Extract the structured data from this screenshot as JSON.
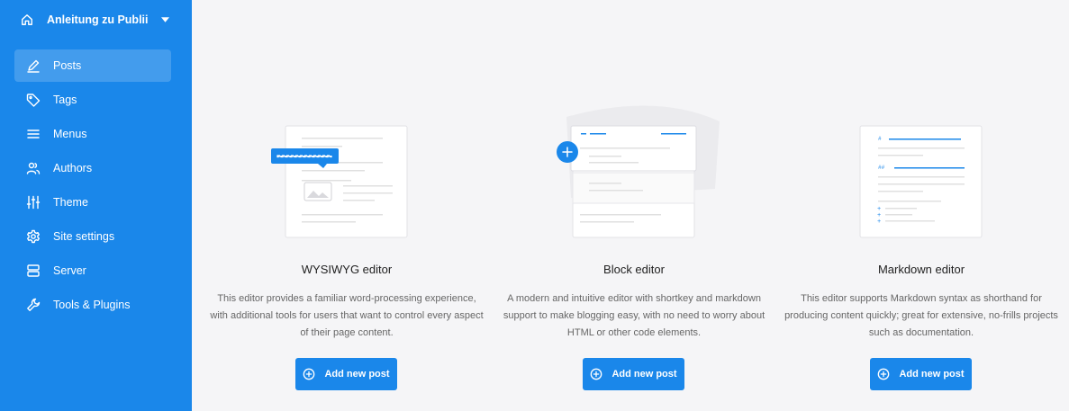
{
  "sidebar": {
    "site_name": "Anleitung zu Publii",
    "items": [
      {
        "label": "Posts",
        "icon": "pencil-icon",
        "active": true
      },
      {
        "label": "Tags",
        "icon": "tag-icon"
      },
      {
        "label": "Menus",
        "icon": "menu-icon"
      },
      {
        "label": "Authors",
        "icon": "users-icon"
      },
      {
        "label": "Theme",
        "icon": "sliders-icon"
      },
      {
        "label": "Site settings",
        "icon": "gear-icon"
      },
      {
        "label": "Server",
        "icon": "server-icon"
      },
      {
        "label": "Tools & Plugins",
        "icon": "wrench-icon"
      }
    ]
  },
  "editors": [
    {
      "title": "WYSIWYG editor",
      "description": "This editor provides a familiar word-processing experience, with additional tools for users that want to control every aspect of their page content.",
      "button": "Add new post"
    },
    {
      "title": "Block editor",
      "description": "A modern and intuitive editor with shortkey and markdown support to make blogging easy, with no need to worry about HTML or other code elements.",
      "button": "Add new post"
    },
    {
      "title": "Markdown editor",
      "description": "This editor supports Markdown syntax as shorthand for producing content quickly; great for extensive, no-frills projects such as documentation.",
      "button": "Add new post"
    }
  ],
  "colors": {
    "accent": "#1a87ea",
    "background": "#f5f5f7"
  }
}
